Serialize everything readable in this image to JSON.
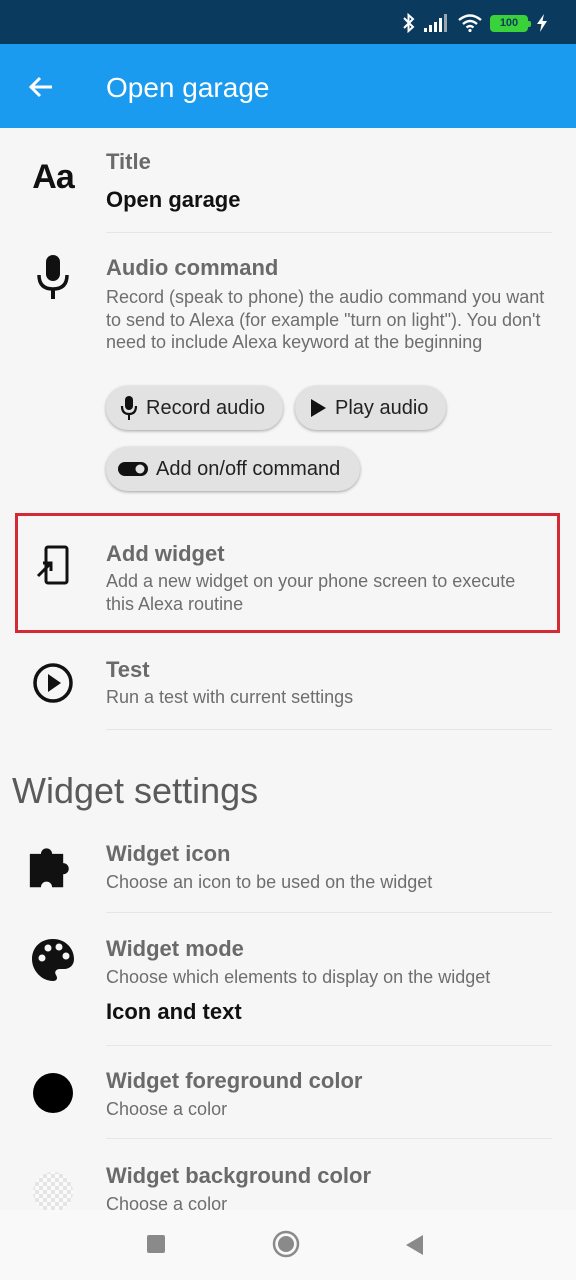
{
  "status_bar": {
    "battery_level": "100"
  },
  "app_bar": {
    "title": "Open garage"
  },
  "title_row": {
    "label": "Title",
    "value": "Open garage"
  },
  "audio_row": {
    "label": "Audio command",
    "description": "Record (speak to phone) the audio command you want to send to Alexa (for example \"turn on light\"). You don't need to include Alexa keyword at the beginning",
    "record_button": "Record audio",
    "play_button": "Play audio",
    "onoff_button": "Add on/off command"
  },
  "widget_row": {
    "label": "Add widget",
    "description": "Add a new widget on your phone screen to execute this Alexa routine"
  },
  "test_row": {
    "label": "Test",
    "description": "Run a test with current settings"
  },
  "widget_settings": {
    "header": "Widget settings",
    "icon": {
      "label": "Widget icon",
      "description": "Choose an icon to be used on the widget"
    },
    "mode": {
      "label": "Widget mode",
      "description": "Choose which elements to display on the widget",
      "value": "Icon and text"
    },
    "foreground": {
      "label": "Widget foreground color",
      "description": "Choose a color",
      "swatch_color": "#000000"
    },
    "background": {
      "label": "Widget background color",
      "description": "Choose a color"
    }
  },
  "colors": {
    "status_bar": "#0a3a5e",
    "app_bar": "#1a9bf0",
    "highlight": "#d32a35",
    "battery": "#3ad23a"
  }
}
